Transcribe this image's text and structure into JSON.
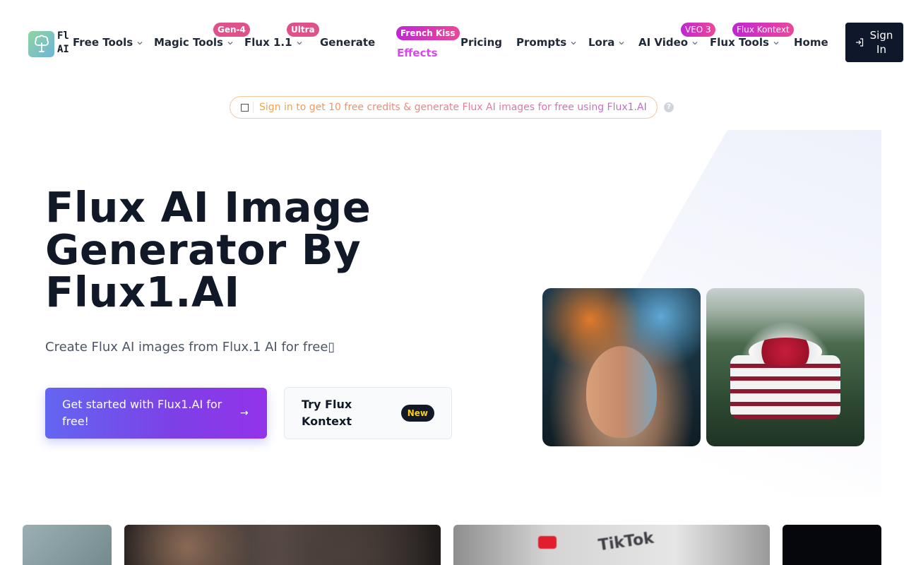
{
  "header": {
    "logo_text": "Flux\nAI",
    "nav": [
      {
        "label": "Free Tools",
        "dropdown": true
      },
      {
        "label": "Magic Tools",
        "dropdown": true,
        "badge": "Gen-4"
      },
      {
        "label": "Flux 1.1",
        "dropdown": true,
        "badge": "Ultra"
      },
      {
        "label": "Generate",
        "dropdown": false
      },
      {
        "label": "Effects",
        "dropdown": false,
        "badge": "French Kiss"
      },
      {
        "label": "Pricing",
        "dropdown": false
      },
      {
        "label": "Prompts",
        "dropdown": true
      },
      {
        "label": "Lora",
        "dropdown": true
      },
      {
        "label": "AI Video",
        "dropdown": true,
        "badge": "VEO 3"
      },
      {
        "label": "Flux Tools",
        "dropdown": true,
        "badge": "Flux Kontext"
      },
      {
        "label": "Home",
        "dropdown": false
      }
    ],
    "sign_in_label": "Sign In"
  },
  "notice": {
    "icon": "gift-icon",
    "text": "Sign in to get 10 free credits & generate Flux AI images for free using Flux1.AI",
    "help": "?"
  },
  "hero": {
    "title": "Flux AI Image Generator By Flux1.AI",
    "subtitle": "Create Flux AI images from Flux.1 AI for free",
    "primary_cta": "Get started with Flux1.AI for free!",
    "secondary_cta": "Try Flux Kontext",
    "secondary_badge": "New",
    "images": [
      "woman-with-flowers-image",
      "cake-in-forest-image"
    ]
  },
  "gallery": {
    "tile3_text": "TikTok"
  },
  "colors": {
    "primary_gradient_start": "#6366f1",
    "primary_gradient_end": "#9333ea",
    "dark": "#0f172a",
    "badge_pink": "#e0508a",
    "new_badge_text": "#facc15"
  }
}
